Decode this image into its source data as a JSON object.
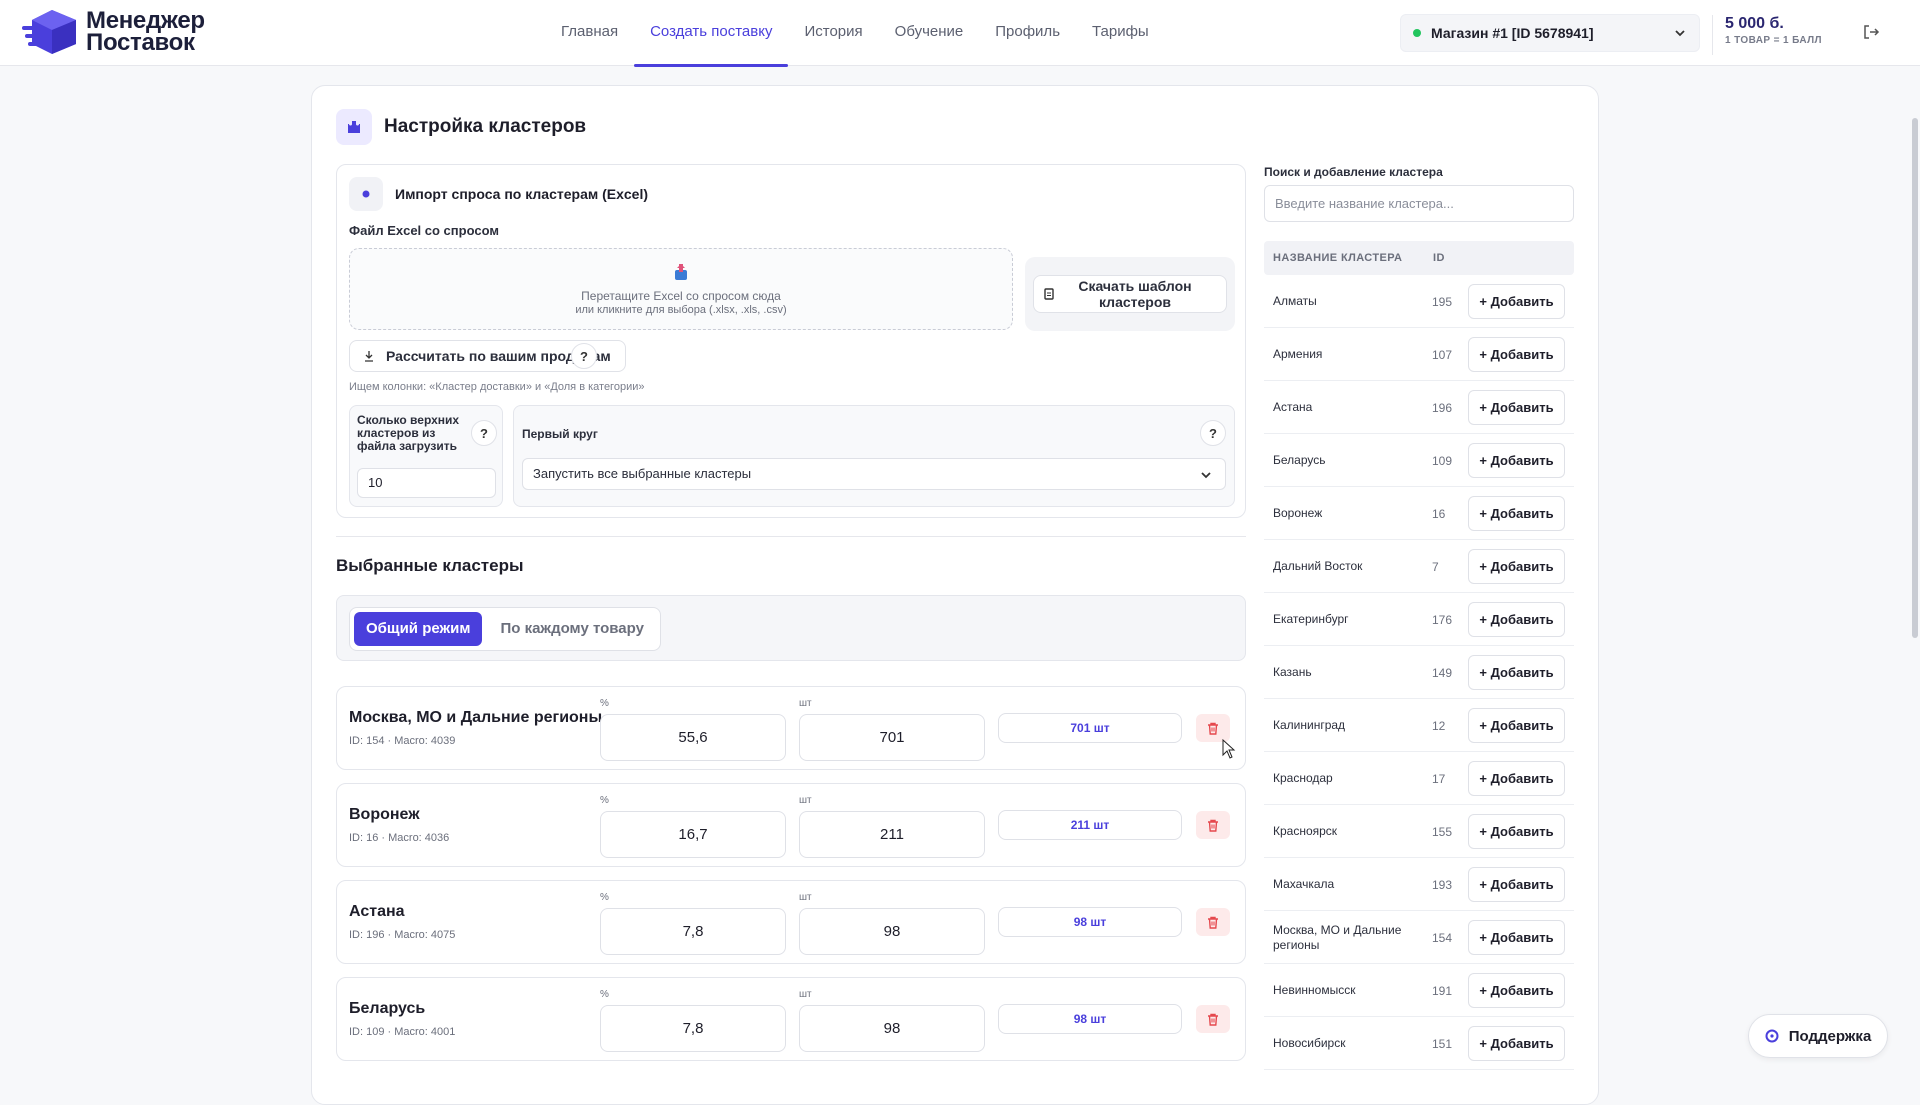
{
  "app": {
    "logo_line1": "Менеджер",
    "logo_line2": "Поставок"
  },
  "nav": {
    "items": [
      "Главная",
      "Создать поставку",
      "История",
      "Обучение",
      "Профиль",
      "Тарифы"
    ],
    "active_index": 1
  },
  "store": {
    "label": "Магазин #1 [ID 5678941]",
    "status_color": "#22c55e"
  },
  "balance": {
    "amount": "5 000 б.",
    "sub": "1 ТОВАР = 1 БАЛЛ"
  },
  "page": {
    "title": "Настройка кластеров"
  },
  "import": {
    "title": "Импорт спроса по кластерам (Excel)",
    "file_label": "Файл Excel со спросом",
    "dropzone_line1": "Перетащите Excel со спросом сюда",
    "dropzone_line2": "или кликните для выбора (.xlsx, .xls, .csv)",
    "template_button": "Скачать шаблон кластеров",
    "calc_button": "Рассчитать по вашим продажам",
    "help": "?",
    "hint": "Ищем колонки: «Кластер доставки» и «Доля в категории»",
    "top_label": "Сколько верхних кластеров из файла загрузить",
    "top_value": "10",
    "round_label": "Первый круг",
    "round_value": "Запустить все выбранные кластеры"
  },
  "selected": {
    "title": "Выбранные кластеры",
    "modes": [
      "Общий режим",
      "По каждому товару"
    ],
    "active_mode": 0,
    "percent_label": "%",
    "pcs_label": "шт",
    "rows": [
      {
        "name": "Москва, МО и Дальние регионы",
        "meta": "ID: 154 · Macro: 4039",
        "percent": "55,6",
        "pcs": "701",
        "count": "701 шт"
      },
      {
        "name": "Воронеж",
        "meta": "ID: 16 · Macro: 4036",
        "percent": "16,7",
        "pcs": "211",
        "count": "211 шт"
      },
      {
        "name": "Астана",
        "meta": "ID: 196 · Macro: 4075",
        "percent": "7,8",
        "pcs": "98",
        "count": "98 шт"
      },
      {
        "name": "Беларусь",
        "meta": "ID: 109 · Macro: 4001",
        "percent": "7,8",
        "pcs": "98",
        "count": "98 шт"
      }
    ]
  },
  "search_panel": {
    "label": "Поиск и добавление кластера",
    "placeholder": "Введите название кластера...",
    "col_name": "НАЗВАНИЕ КЛАСТЕРА",
    "col_id": "ID",
    "add_label": "+ Добавить",
    "rows": [
      {
        "name": "Алматы",
        "id": "195"
      },
      {
        "name": "Армения",
        "id": "107"
      },
      {
        "name": "Астана",
        "id": "196"
      },
      {
        "name": "Беларусь",
        "id": "109"
      },
      {
        "name": "Воронеж",
        "id": "16"
      },
      {
        "name": "Дальний Восток",
        "id": "7"
      },
      {
        "name": "Екатеринбург",
        "id": "176"
      },
      {
        "name": "Казань",
        "id": "149"
      },
      {
        "name": "Калининград",
        "id": "12"
      },
      {
        "name": "Краснодар",
        "id": "17"
      },
      {
        "name": "Красноярск",
        "id": "155"
      },
      {
        "name": "Махачкала",
        "id": "193"
      },
      {
        "name": "Москва, МО и Дальние регионы",
        "id": "154"
      },
      {
        "name": "Невинномысск",
        "id": "191"
      },
      {
        "name": "Новосибирск",
        "id": "151"
      }
    ]
  },
  "support": {
    "label": "Поддержка"
  },
  "colors": {
    "accent": "#4a3fdc",
    "danger": "#e5484d"
  }
}
